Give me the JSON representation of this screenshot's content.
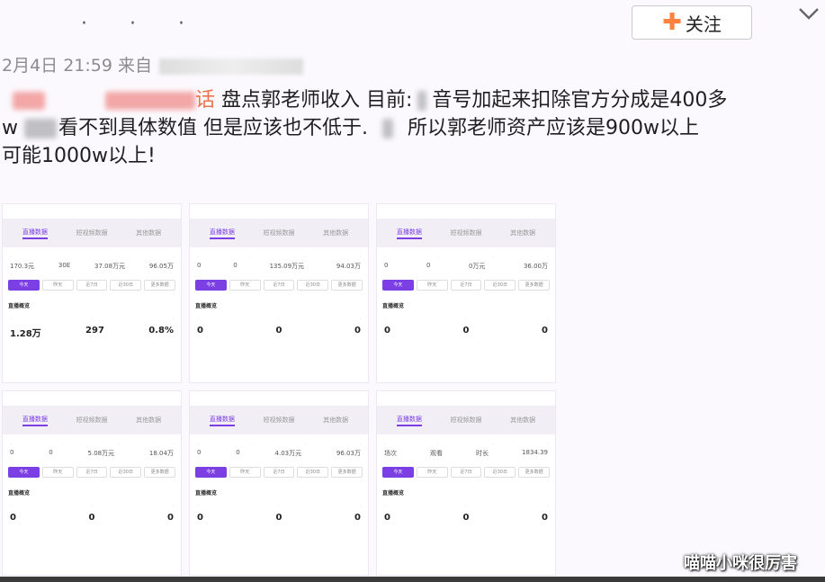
{
  "header": {
    "dots": "· · ·",
    "follow_label": "关注",
    "follow_plus": "✚",
    "chevron": "chevron-down-icon"
  },
  "meta": {
    "timestamp": "2月4日 21:59",
    "source_prefix": "来自 "
  },
  "post": {
    "handle_suffix": "话",
    "line1": " 盘点郭老师收入 目前:",
    "line1b": "音号加起来扣除官方分成是400多",
    "line2a": "w ",
    "line2b": "看不到具体数值 但是应该也不低于.",
    "line2c": "所以郭老师资产应该是900w以上",
    "line3": "可能1000w以上!"
  },
  "cards": {
    "tab1": "直播数据",
    "tab2": "短视频数据",
    "tab3": "其他数据",
    "pills": [
      "今天",
      "昨天",
      "近7日",
      "近30日",
      "更多数据"
    ],
    "section": "直播概览",
    "c1": {
      "n1": "170.3元",
      "n2": "30E",
      "n3": "37.08万元",
      "n4": "96.05万",
      "b1": "1.28万",
      "b2": "297",
      "b3": "0.8%"
    },
    "c2": {
      "n1": "0",
      "n2": "0",
      "n3": "135.09万元",
      "n4": "94.03万",
      "b1": "0",
      "b2": "0",
      "b3": "0"
    },
    "c3": {
      "n1": "0",
      "n2": "0",
      "n3": "0万元",
      "n4": "36.00万",
      "b1": "0",
      "b2": "0",
      "b3": "0"
    },
    "c4": {
      "n1": "0",
      "n2": "0",
      "n3": "5.08万元",
      "n4": "18.04万",
      "b1": "0",
      "b2": "0",
      "b3": "0"
    },
    "c5": {
      "n1": "0",
      "n2": "0",
      "n3": "4.03万元",
      "n4": "96.03万",
      "b1": "0",
      "b2": "0",
      "b3": "0"
    },
    "c6": {
      "n1": "场次",
      "n2": "观看",
      "n3": "时长",
      "n4": "1834.39",
      "b1": "0",
      "b2": "0",
      "b3": "0"
    }
  },
  "watermark": "喵喵小咪很厉害"
}
